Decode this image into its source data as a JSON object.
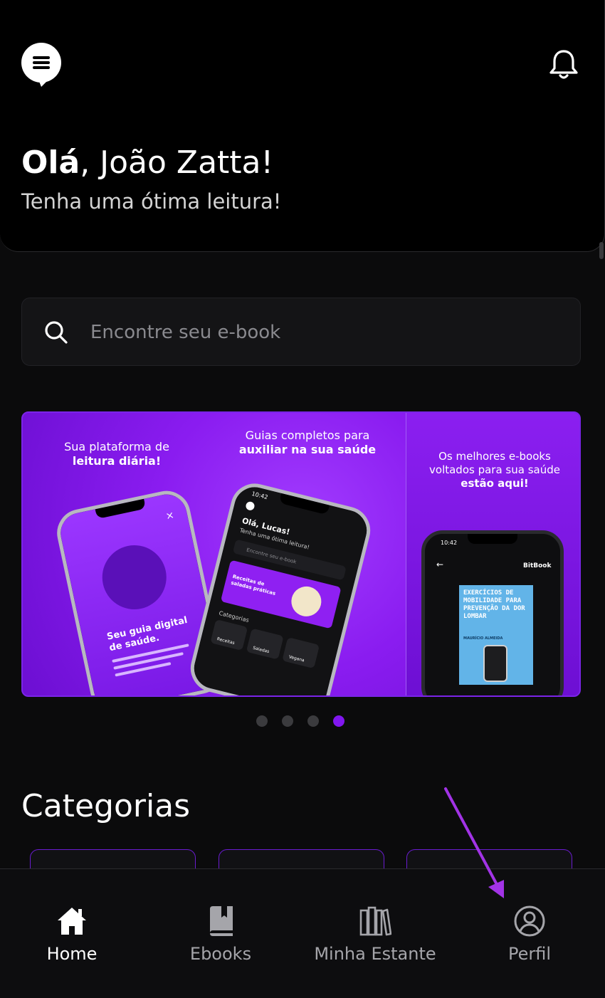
{
  "header": {
    "greeting_prefix": "Olá",
    "greeting_name": ", João Zatta!",
    "subtitle": "Tenha uma ótima leitura!"
  },
  "search": {
    "placeholder": "Encontre seu e-book"
  },
  "banner": {
    "slide1": {
      "line1": "Sua plataforma de",
      "line2": "leitura diária!",
      "phone_title_1": "Seu guia digital",
      "phone_title_2": "de saúde."
    },
    "slide2": {
      "line1": "Guias completos para",
      "line2": "auxiliar na sua saúde",
      "phone_greeting": "Olá, Lucas!",
      "phone_subtitle": "Tenha uma ótima leitura!",
      "phone_search": "Encontre seu e-book",
      "phone_card": "Receitas de saladas práticas",
      "phone_categories": "Categorias",
      "cat1": "Receitas",
      "cat2": "Saladas",
      "cat3": "Vegana",
      "time": "10:42"
    },
    "slide3": {
      "line1": "Os melhores e-books",
      "line2": "voltados para sua saúde",
      "line3": "estão aqui!",
      "time": "10:42",
      "app_name": "BitBook",
      "book_title": "EXERCÍCIOS DE MOBILIDADE PARA PREVENÇÃO DA DOR LOMBAR",
      "book_author": "MAURÍCIO ALMEIDA"
    },
    "active_dot": 4,
    "dot_count": 4
  },
  "categories": {
    "title": "Categorias"
  },
  "tabbar": {
    "items": [
      {
        "label": "Home",
        "icon": "home-icon",
        "active": true
      },
      {
        "label": "Ebooks",
        "icon": "book-icon",
        "active": false
      },
      {
        "label": "Minha Estante",
        "icon": "bookshelf-icon",
        "active": false
      },
      {
        "label": "Perfil",
        "icon": "profile-icon",
        "active": false
      }
    ]
  },
  "colors": {
    "accent": "#8117ef",
    "background": "#0b0b0c",
    "header_bg": "#000000",
    "annotation_arrow": "#a233e6"
  }
}
